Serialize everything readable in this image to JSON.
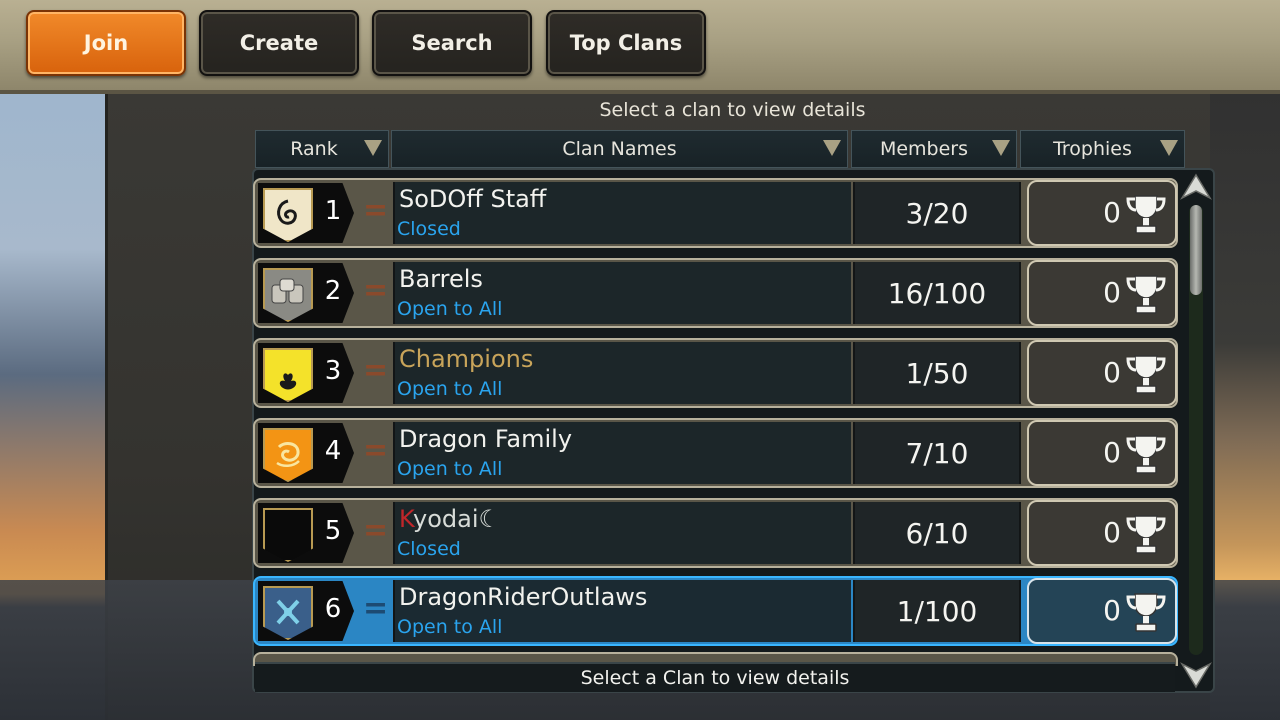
{
  "tabs": [
    {
      "label": "Join",
      "active": true
    },
    {
      "label": "Create",
      "active": false
    },
    {
      "label": "Search",
      "active": false
    },
    {
      "label": "Top Clans",
      "active": false
    }
  ],
  "subtitle": "Select a clan to view details",
  "columns": {
    "rank": "Rank",
    "names": "Clan Names",
    "members": "Members",
    "trophies": "Trophies"
  },
  "clans": [
    {
      "rank": "1",
      "name": "SoDOff Staff",
      "status": "Closed",
      "members": "3/20",
      "trophies": "0",
      "crest": "dragon-crest-icon"
    },
    {
      "rank": "2",
      "name": "Barrels",
      "status": "Open to All",
      "members": "16/100",
      "trophies": "0",
      "crest": "barrels-crest-icon"
    },
    {
      "rank": "3",
      "name": "Champions",
      "status": "Open to All",
      "members": "1/50",
      "trophies": "0",
      "crest": "flame-crest-icon"
    },
    {
      "rank": "4",
      "name": "Dragon Family",
      "status": "Open to All",
      "members": "7/10",
      "trophies": "0",
      "crest": "dragon-swirl-crest-icon"
    },
    {
      "rank": "5",
      "name_first": "K",
      "name_rest": "yodai☾",
      "status": "Closed",
      "members": "6/10",
      "trophies": "0",
      "crest": "blank-crest-icon"
    },
    {
      "rank": "6",
      "name": "DragonRiderOutlaws",
      "status": "Open to All",
      "members": "1/100",
      "trophies": "0",
      "crest": "crossed-weapons-crest-icon",
      "selected": true
    }
  ],
  "equal_symbol": "=",
  "footer": "Select a Clan to view details",
  "colors": {
    "active_tab": "#e8741a",
    "status_text": "#2aa4ee",
    "selected_row": "#2b86c4"
  }
}
